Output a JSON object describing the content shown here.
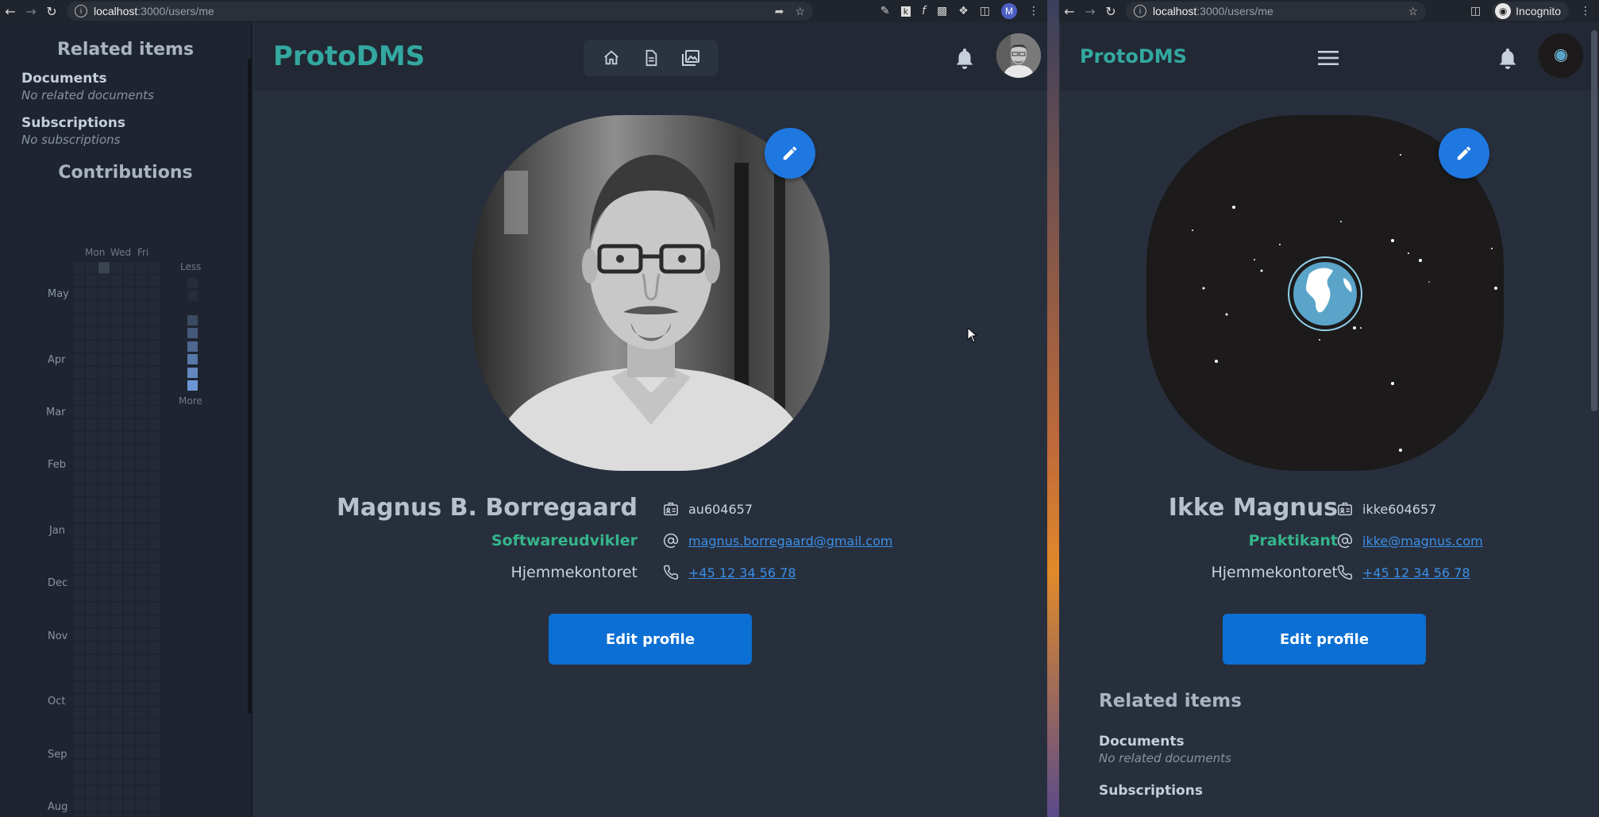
{
  "left": {
    "url_host": "localhost",
    "url_path": ":3000/users/me",
    "profile_initial": "M",
    "sidebar": {
      "related_title": "Related items",
      "documents_label": "Documents",
      "documents_empty": "No related documents",
      "subscriptions_label": "Subscriptions",
      "subscriptions_empty": "No subscriptions",
      "contributions_title": "Contributions",
      "day_labels": [
        "Mon",
        "Wed",
        "Fri"
      ],
      "legend_less": "Less",
      "legend_more": "More",
      "months": [
        "May",
        "Apr",
        "Mar",
        "Feb",
        "Jan",
        "Dec",
        "Nov",
        "Oct",
        "Sep",
        "Aug"
      ]
    },
    "app": {
      "logo": "ProtoDMS"
    },
    "profile": {
      "name": "Magnus B. Borregaard",
      "title": "Softwareudvikler",
      "location": "Hjemmekontoret",
      "employee_id": "au604657",
      "email": "magnus.borregaard@gmail.com",
      "phone": "+45 12 34 56 78",
      "edit_button": "Edit profile"
    }
  },
  "right": {
    "url_host": "localhost",
    "url_path": ":3000/users/me",
    "incognito_label": "Incognito",
    "app": {
      "logo": "ProtoDMS"
    },
    "profile": {
      "name": "Ikke Magnus",
      "title": "Praktikant",
      "location": "Hjemmekontoret",
      "employee_id": "ikke604657",
      "email": "ikke@magnus.com",
      "phone": "+45 12 34 56 78",
      "edit_button": "Edit profile"
    },
    "related": {
      "title": "Related items",
      "documents_label": "Documents",
      "documents_empty": "No related documents",
      "subscriptions_label": "Subscriptions"
    }
  },
  "colors": {
    "accent_teal": "#33a8a0",
    "title_green": "#34b58a",
    "primary_blue": "#0b6fd3",
    "link_blue": "#3a8fe8",
    "background": "#282f3c"
  }
}
